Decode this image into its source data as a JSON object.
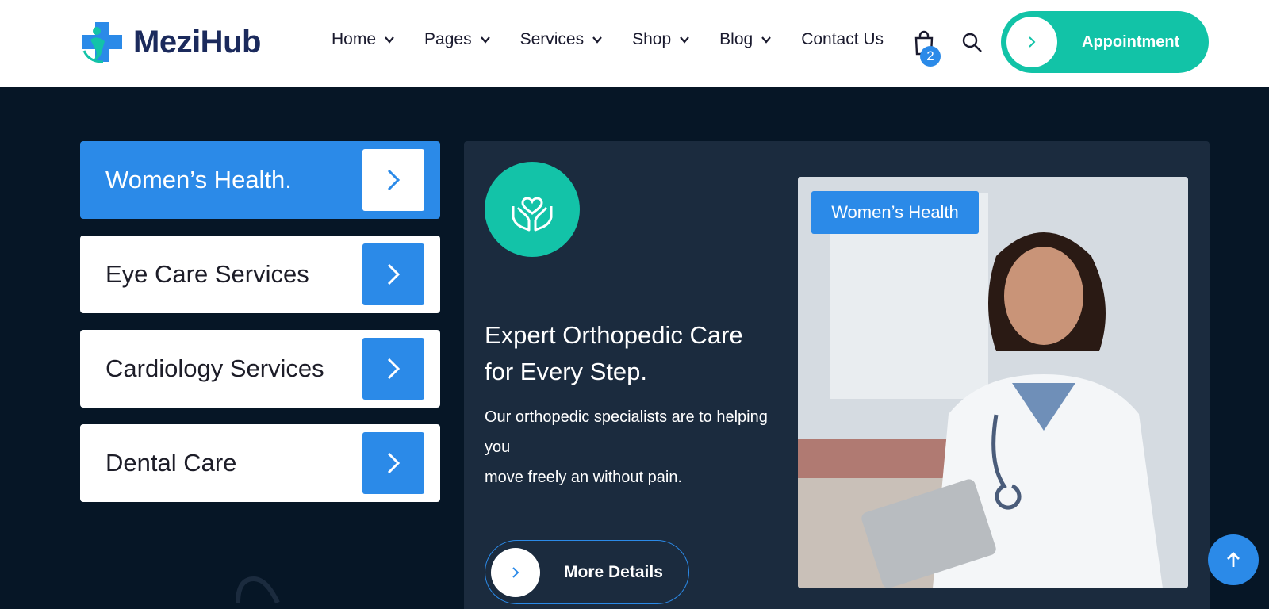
{
  "header": {
    "logo_text": "MeziHub",
    "nav": [
      {
        "label": "Home",
        "has_dropdown": true
      },
      {
        "label": "Pages",
        "has_dropdown": true
      },
      {
        "label": "Services",
        "has_dropdown": true
      },
      {
        "label": "Shop",
        "has_dropdown": true
      },
      {
        "label": "Blog",
        "has_dropdown": true
      },
      {
        "label": "Contact Us",
        "has_dropdown": false
      }
    ],
    "cart_count": "2",
    "appointment_label": "Appointment"
  },
  "services_menu": {
    "items": [
      {
        "label": "Women’s Health.",
        "active": true
      },
      {
        "label": "Eye Care Services",
        "active": false
      },
      {
        "label": "Cardiology Services",
        "active": false
      },
      {
        "label": "Dental Care",
        "active": false
      }
    ]
  },
  "feature": {
    "icon": "hands-heart-icon",
    "title_line1": "Expert Orthopedic Care",
    "title_line2": "for Every Step.",
    "desc_line1": "Our orthopedic specialists are to helping",
    "desc_line2": "you",
    "desc_line3": "move freely an without pain.",
    "button_label": "More Details",
    "image_tag": "Women’s Health"
  },
  "colors": {
    "primary_blue": "#2b8ae8",
    "teal": "#13c3a8",
    "navy_bg": "#061626",
    "panel_bg": "#1b2b3e"
  }
}
